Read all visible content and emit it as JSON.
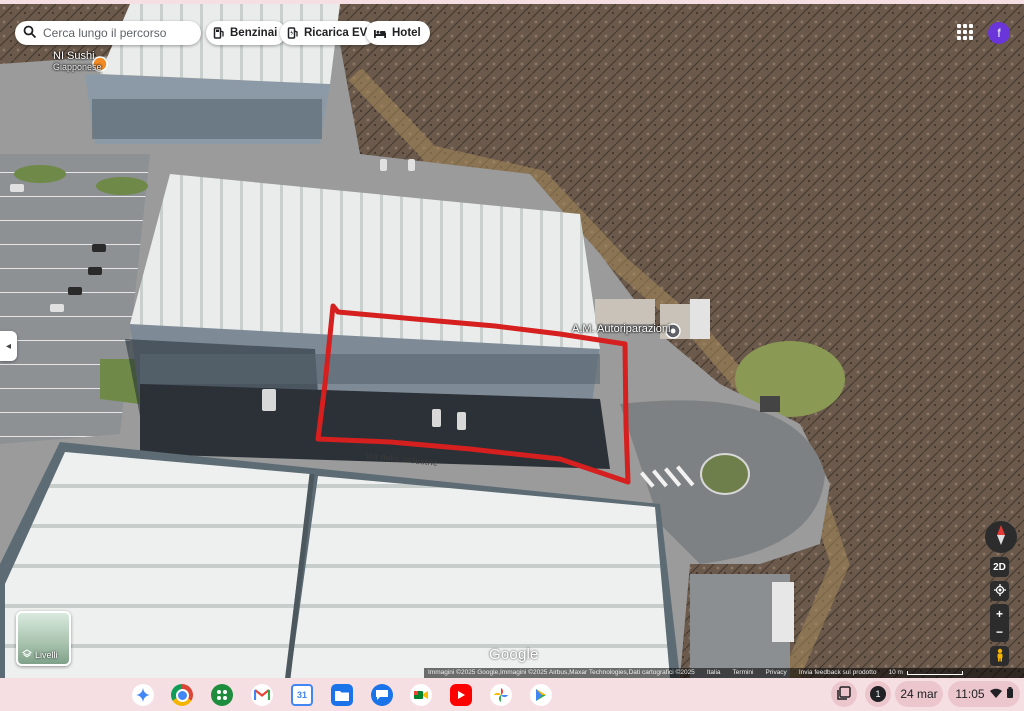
{
  "map": {
    "search_placeholder": "Cerca lungo il percorso",
    "chips": [
      {
        "label": "Benzinai",
        "icon": "gas-station-icon"
      },
      {
        "label": "Ricarica EV",
        "icon": "ev-charger-icon"
      },
      {
        "label": "Hotel",
        "icon": "bed-icon"
      }
    ],
    "account_initial": "f",
    "poi_sushi_name": "NI Sushi",
    "poi_sushi_sub": "Giapponese",
    "poi_auto_name": "A.M. Autoriparazioni",
    "street_label": "Via delle Industrie",
    "layers_label": "Livelli",
    "view_mode": "2D",
    "zoom_in": "+",
    "zoom_out": "−",
    "logo": "Google",
    "attribution": {
      "imagery": "Immagini ©2025 Google,Immagini ©2025 Airbus,Maxar Technologies,Dati cartografici ©2025",
      "country": "Italia",
      "terms": "Termini",
      "privacy": "Privacy",
      "feedback": "Invia feedback sul prodotto",
      "scale": "10 m"
    }
  },
  "shelf": {
    "apps": [
      {
        "name": "gemini-icon",
        "color": "#ffffff"
      },
      {
        "name": "chrome-icon",
        "color": "#db4437"
      },
      {
        "name": "launcher-apps-icon",
        "color": "#1e8e3e"
      },
      {
        "name": "gmail-icon",
        "color": "#ffffff"
      },
      {
        "name": "calendar-icon",
        "color": "#ffffff"
      },
      {
        "name": "files-icon",
        "color": "#1a73e8"
      },
      {
        "name": "messages-icon",
        "color": "#1a73e8"
      },
      {
        "name": "meet-icon",
        "color": "#ffffff"
      },
      {
        "name": "youtube-icon",
        "color": "#ff0000"
      },
      {
        "name": "photos-icon",
        "color": "#ffffff"
      },
      {
        "name": "play-store-icon",
        "color": "#ffffff"
      }
    ],
    "calendar_day": "31",
    "notification_count": "1",
    "date": "24 mar",
    "time": "11:05"
  },
  "colors": {
    "highlight": "#d61f1f",
    "avatar": "#6a35d9"
  }
}
